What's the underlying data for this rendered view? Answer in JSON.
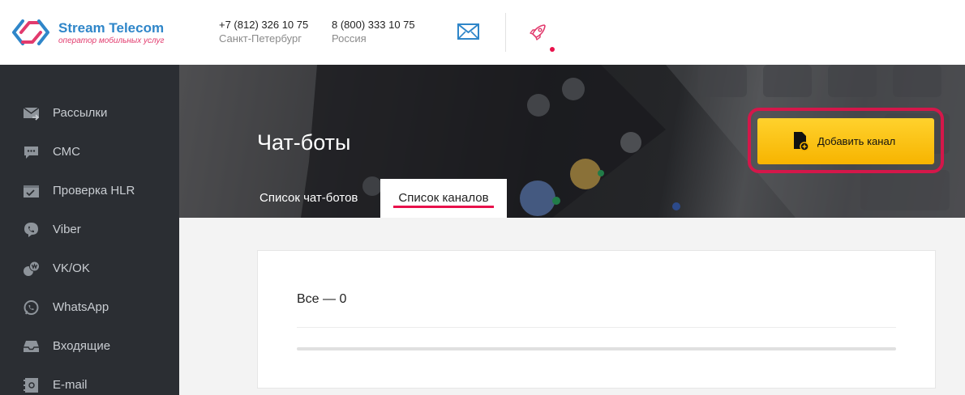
{
  "header": {
    "logo": {
      "name": "Stream Telecom",
      "tagline": "оператор мобильных услуг"
    },
    "contacts": [
      {
        "phone": "+7 (812) 326 10 75",
        "city": "Санкт-Петербург"
      },
      {
        "phone": "8 (800) 333 10 75",
        "city": "Россия"
      }
    ],
    "icons": [
      "envelope-icon",
      "rocket-icon"
    ]
  },
  "sidebar": {
    "items": [
      {
        "label": "Рассылки",
        "icon": "mail-send-icon"
      },
      {
        "label": "СМС",
        "icon": "sms-bubble-icon"
      },
      {
        "label": "Проверка HLR",
        "icon": "hlr-check-icon"
      },
      {
        "label": "Viber",
        "icon": "viber-icon"
      },
      {
        "label": "VK/OK",
        "icon": "vk-ok-icon"
      },
      {
        "label": "WhatsApp",
        "icon": "whatsapp-icon"
      },
      {
        "label": "Входящие",
        "icon": "inbox-icon"
      },
      {
        "label": "E-mail",
        "icon": "email-icon"
      }
    ]
  },
  "page": {
    "title": "Чат-боты",
    "tabs": [
      {
        "label": "Список чат-ботов",
        "active": false
      },
      {
        "label": "Список каналов",
        "active": true
      }
    ],
    "add_button_label": "Добавить канал",
    "count_text": "Все — 0"
  },
  "colors": {
    "accent": "#e8114b",
    "brand_blue": "#2f86c9",
    "button_yellow": "#f7b400",
    "sidebar_bg": "#2b2e33"
  }
}
